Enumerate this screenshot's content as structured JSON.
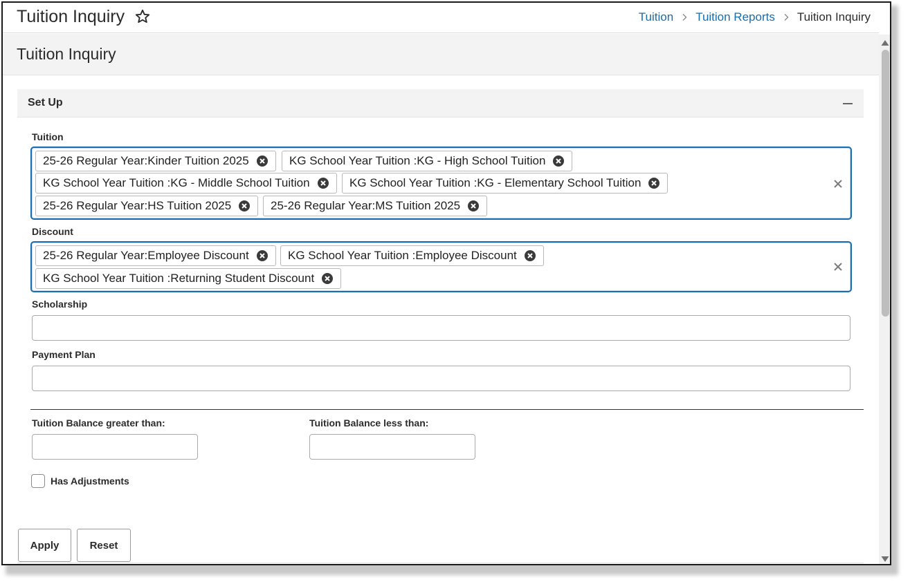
{
  "header": {
    "title": "Tuition Inquiry",
    "favorite_icon": "star-outline-icon",
    "breadcrumb": [
      {
        "label": "Tuition",
        "link": true
      },
      {
        "label": "Tuition Reports",
        "link": true
      },
      {
        "label": "Tuition Inquiry",
        "link": false
      }
    ]
  },
  "page": {
    "title": "Tuition Inquiry"
  },
  "panel": {
    "title": "Set Up",
    "collapse_icon": "minus-icon"
  },
  "tuition": {
    "label": "Tuition",
    "selected": [
      "25-26 Regular Year:Kinder Tuition 2025",
      "KG School Year Tuition :KG - High School Tuition",
      "KG School Year Tuition :KG - Middle School Tuition",
      "KG School Year Tuition :KG - Elementary School Tuition",
      "25-26 Regular Year:HS Tuition 2025",
      "25-26 Regular Year:MS Tuition 2025"
    ]
  },
  "discount": {
    "label": "Discount",
    "selected": [
      "25-26 Regular Year:Employee Discount",
      "KG School Year Tuition :Employee Discount",
      "KG School Year Tuition :Returning Student Discount"
    ]
  },
  "scholarship": {
    "label": "Scholarship",
    "value": ""
  },
  "payment_plan": {
    "label": "Payment Plan",
    "value": ""
  },
  "balance": {
    "greater_label": "Tuition Balance greater than:",
    "greater_value": "",
    "less_label": "Tuition Balance less than:",
    "less_value": ""
  },
  "adjustments": {
    "label": "Has Adjustments",
    "checked": false
  },
  "buttons": {
    "apply": "Apply",
    "reset": "Reset"
  },
  "colors": {
    "accent": "#1a6cae",
    "panel_bg": "#f3f3f3"
  }
}
